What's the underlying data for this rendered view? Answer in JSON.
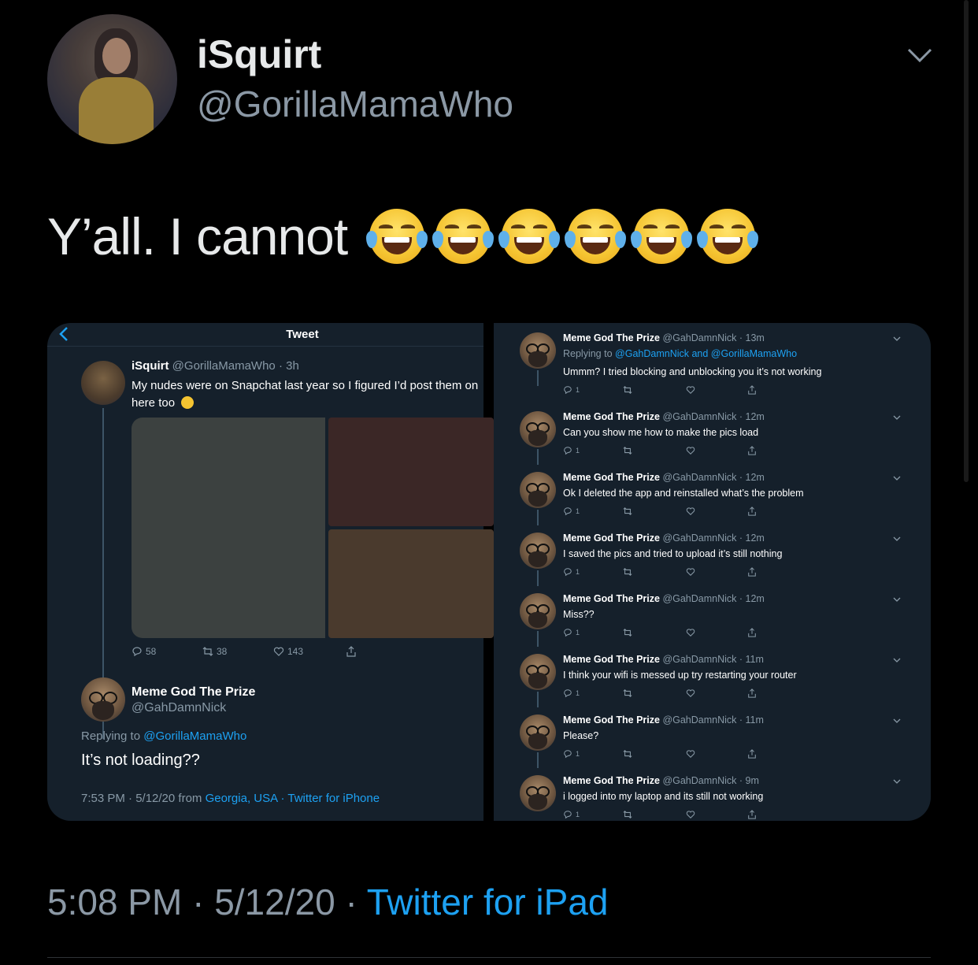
{
  "author": {
    "display_name": "iSquirt",
    "handle": "@GorillaMamaWho"
  },
  "tweet": {
    "text": "Y’all. I cannot",
    "emoji": [
      "face-with-tears-of-joy",
      "face-with-tears-of-joy",
      "face-with-tears-of-joy",
      "face-with-tears-of-joy",
      "face-with-tears-of-joy",
      "face-with-tears-of-joy"
    ]
  },
  "left_screenshot": {
    "header_title": "Tweet",
    "original": {
      "name": "iSquirt",
      "handle": "@GorillaMamaWho",
      "time": "· 3h",
      "text": "My nudes were on Snapchat last year so I figured I’d post them on here too",
      "reply_count": "58",
      "retweet_count": "38",
      "like_count": "143"
    },
    "reply": {
      "name": "Meme God The Prize",
      "handle": "@GahDamnNick",
      "replying_prefix": "Replying to",
      "replying_to": "@GorillaMamaWho",
      "text": "It’s not loading??",
      "time": "7:53 PM · 5/12/20 from",
      "location": "Georgia, USA",
      "separator": " · ",
      "client": "Twitter for iPhone"
    }
  },
  "right_screenshot": {
    "tweets": [
      {
        "name": "Meme God The Prize",
        "meta": "@GahDamnNick · 13m",
        "replying": "Replying to",
        "replying_to": "@GahDamnNick and @GorillaMamaWho",
        "text": "Ummm? I tried blocking and unblocking you it’s not working",
        "replies": "1"
      },
      {
        "name": "Meme God The Prize",
        "meta": "@GahDamnNick · 12m",
        "text": "Can you show me how to make the pics load",
        "replies": "1"
      },
      {
        "name": "Meme God The Prize",
        "meta": "@GahDamnNick · 12m",
        "text": "Ok I deleted the app and reinstalled what’s the problem",
        "replies": "1"
      },
      {
        "name": "Meme God The Prize",
        "meta": "@GahDamnNick · 12m",
        "text": "I saved the pics and tried to upload it’s still nothing",
        "replies": "1"
      },
      {
        "name": "Meme God The Prize",
        "meta": "@GahDamnNick · 12m",
        "text": "Miss??",
        "replies": "1"
      },
      {
        "name": "Meme God The Prize",
        "meta": "@GahDamnNick · 11m",
        "text": "I think your wifi is messed up try restarting your router",
        "replies": "1"
      },
      {
        "name": "Meme God The Prize",
        "meta": "@GahDamnNick · 11m",
        "text": "Please?",
        "replies": "1"
      },
      {
        "name": "Meme God The Prize",
        "meta": "@GahDamnNick · 9m",
        "text": "i logged into my laptop and its still not working",
        "replies": "1"
      }
    ]
  },
  "footer": {
    "timestamp": "5:08 PM · 5/12/20 · ",
    "source": "Twitter for iPad"
  },
  "colors": {
    "background": "#000000",
    "panel": "#15202b",
    "link": "#1da1f2",
    "muted": "#8b98a5"
  }
}
